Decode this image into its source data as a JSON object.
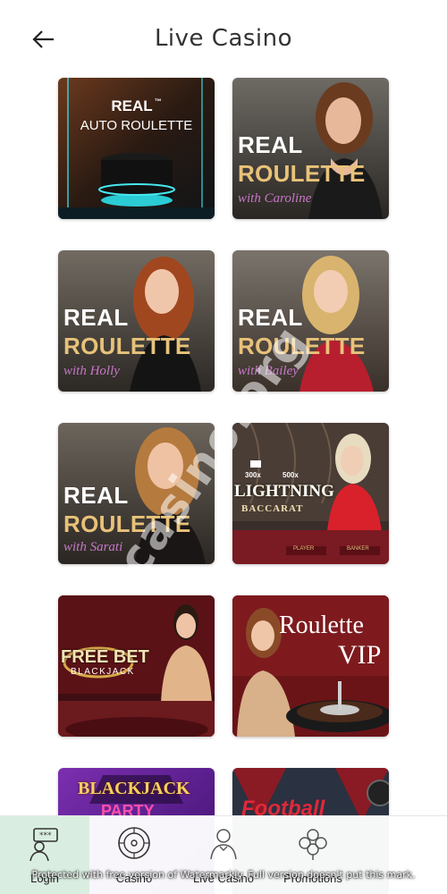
{
  "header": {
    "title": "Live Casino",
    "back_icon": "arrow-left-icon"
  },
  "games": [
    {
      "id": "auto-roulette",
      "line1": "REAL",
      "line2": "AUTO ROULETTE",
      "tm": "™"
    },
    {
      "id": "roulette-caroline",
      "line1": "REAL",
      "line2": "ROULETTE",
      "line3": "with Caroline"
    },
    {
      "id": "roulette-holly",
      "line1": "REAL",
      "line2": "ROULETTE",
      "line3": "with Holly"
    },
    {
      "id": "roulette-bailey",
      "line1": "REAL",
      "line2": "ROULETTE",
      "line3": "with Bailey"
    },
    {
      "id": "roulette-sarati",
      "line1": "REAL",
      "line2": "ROULETTE",
      "line3": "with Sarati"
    },
    {
      "id": "lightning-baccarat",
      "line1": "LIGHTNING",
      "line2": "BACCARAT",
      "badge1": "300x",
      "badge2": "500x",
      "table1": "PLAYER",
      "table2": "BANKER"
    },
    {
      "id": "free-bet-blackjack",
      "line1": "FREE BET",
      "line2": "BLACKJACK"
    },
    {
      "id": "roulette-vip",
      "line1": "Roulette",
      "line2": "VIP"
    },
    {
      "id": "blackjack-party",
      "line1": "BLACKJACK",
      "line2": "PARTY"
    },
    {
      "id": "football-studio",
      "line1": "Football"
    }
  ],
  "nav": [
    {
      "label": "Login",
      "icon": "login-icon"
    },
    {
      "label": "Casino",
      "icon": "roulette-wheel-icon"
    },
    {
      "label": "Live Casino",
      "icon": "dealer-icon"
    },
    {
      "label": "Promotions",
      "icon": "clover-icon"
    },
    {
      "label": "",
      "icon": ""
    }
  ],
  "watermark": {
    "diagonal": "casino.org",
    "bottom": "Protected with free version of Watermarkly. Full version doesn't put this mark."
  },
  "colors": {
    "accent_gold": "#e8c27a",
    "nav_active_bg": "#d9eee0",
    "script_pink": "#c678c9"
  }
}
